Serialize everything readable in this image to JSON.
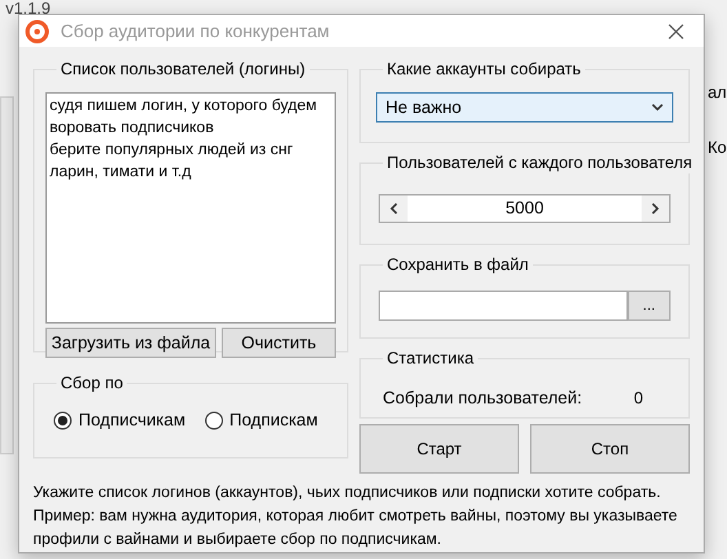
{
  "background_app": {
    "version": "v1.1.9",
    "edge_labels": [
      "ал",
      "Ко"
    ]
  },
  "window": {
    "title": "Сбор аудитории по конкурентам"
  },
  "users_group": {
    "title": "Список пользователей (логины)",
    "text": "судя пишем логин, у которого будем\nворовать подписчиков\nберите популярных людей из снг\nларин, тимати и т.д",
    "buttons": [
      "Загрузить из файла",
      "Очистить"
    ]
  },
  "collect_by": {
    "title": "Сбор по",
    "options": [
      {
        "label": "Подписчикам",
        "selected": true
      },
      {
        "label": "Подпискам",
        "selected": false
      }
    ]
  },
  "accounts_group": {
    "title": "Какие аккаунты собирать",
    "value": "Не важно"
  },
  "per_user_group": {
    "title": "Пользователей с каждого пользователя",
    "value": "5000"
  },
  "save_group": {
    "title": "Сохранить в файл",
    "browse": "..."
  },
  "stats_group": {
    "title": "Статистика",
    "label": "Собрали пользователей:",
    "value": "0"
  },
  "actions": [
    "Старт",
    "Стоп"
  ],
  "help": [
    "Укажите список логинов (аккаунтов), чьих подписчиков или подписки хотите собрать.",
    "Пример: вам нужна аудитория, которая любит смотреть вайны, поэтому вы указываете профили с вайнами и выбираете сбор по подписчикам."
  ]
}
